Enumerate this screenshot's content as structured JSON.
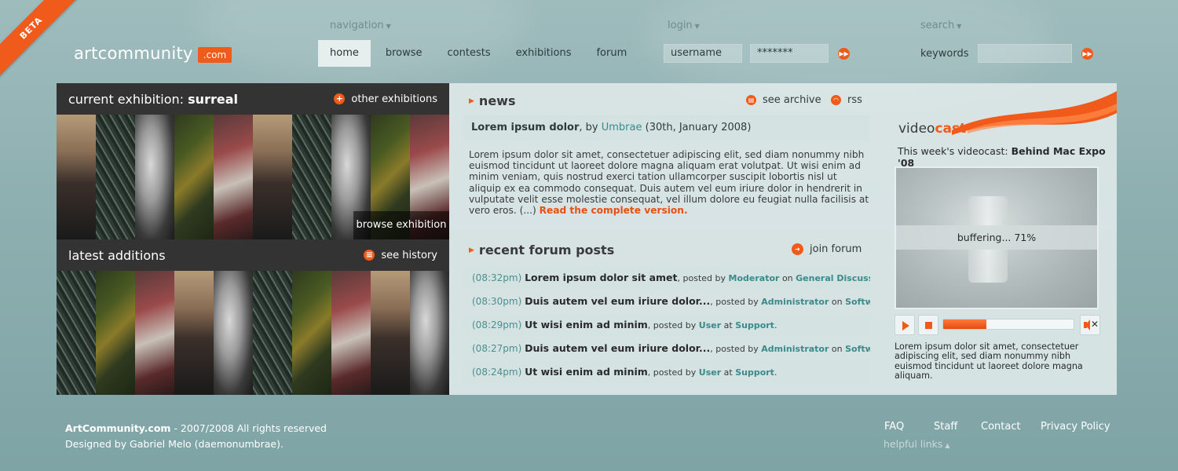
{
  "beta_label": "BETA",
  "logo": {
    "name": "artcommunity",
    "tld": ".com"
  },
  "labels": {
    "navigation": "navigation",
    "login": "login",
    "search": "search"
  },
  "nav": [
    "home",
    "browse",
    "contests",
    "exhibitions",
    "forum"
  ],
  "login": {
    "username": "username",
    "password": "*******"
  },
  "search": {
    "label": "keywords",
    "value": ""
  },
  "exhibition": {
    "title_prefix": "current exhibition: ",
    "title_bold": "surreal",
    "link": "other exhibitions",
    "browse": "browse exhibition"
  },
  "latest": {
    "title": "latest additions",
    "link": "see history"
  },
  "news": {
    "heading": "news",
    "archive": "see archive",
    "rss": "rss",
    "headline": "Lorem ipsum dolor",
    "by": ", by ",
    "author": "Umbrae",
    "date": " (30th, January 2008)",
    "body": "Lorem ipsum dolor sit amet, consectetuer adipiscing elit, sed diam nonummy nibh euismod tincidunt ut laoreet dolore magna aliquam erat volutpat. Ut wisi enim ad minim veniam, quis nostrud exerci tation ullamcorper suscipit lobortis nisl ut aliquip ex ea commodo consequat. Duis autem vel eum iriure dolor in hendrerit in vulputate velit esse molestie consequat, vel illum dolore eu feugiat nulla facilisis at vero eros. (...) ",
    "more": "Read the complete version."
  },
  "forum": {
    "heading": "recent forum posts",
    "join": "join forum",
    "posts": [
      {
        "time": "(08:32pm)",
        "title": "Lorem ipsum dolor sit amet",
        "user": "Moderator",
        "prep": " on ",
        "where": "General Discussion"
      },
      {
        "time": "(08:30pm)",
        "title": "Duis autem vel eum iriure dolor...",
        "user": "Administrator",
        "prep": " on ",
        "where": "Software"
      },
      {
        "time": "(08:29pm)",
        "title": "Ut wisi enim ad minim",
        "user": "User",
        "prep": " at ",
        "where": "Support"
      },
      {
        "time": "(08:27pm)",
        "title": "Duis autem vel eum iriure dolor...",
        "user": "Administrator",
        "prep": " on ",
        "where": "Software"
      },
      {
        "time": "(08:24pm)",
        "title": "Ut wisi enim ad minim",
        "user": "User",
        "prep": " at ",
        "where": "Support"
      }
    ],
    "posted_by": ", posted by "
  },
  "videocast": {
    "title_a": "video",
    "title_b": "cast",
    "week_prefix": "This week's videocast: ",
    "week_title": "Behind Mac Expo '08",
    "buffering": "buffering... 71%",
    "progress": 0.33,
    "desc": "Lorem ipsum dolor sit amet, consectetuer adipiscing elit, sed diam nonummy nibh euismod tincidunt ut laoreet dolore magna aliquam."
  },
  "footer": {
    "site": "ArtCommunity.com",
    "rights": " - 2007/2008 All rights reserved",
    "designer": "Designed by Gabriel Melo (daemonumbrae).",
    "links": [
      "FAQ",
      "Staff",
      "Contact",
      "Privacy Policy"
    ],
    "helpful": "helpful links"
  },
  "colors": {
    "accent": "#f05a1a",
    "teal_link": "#3a8a8a"
  }
}
